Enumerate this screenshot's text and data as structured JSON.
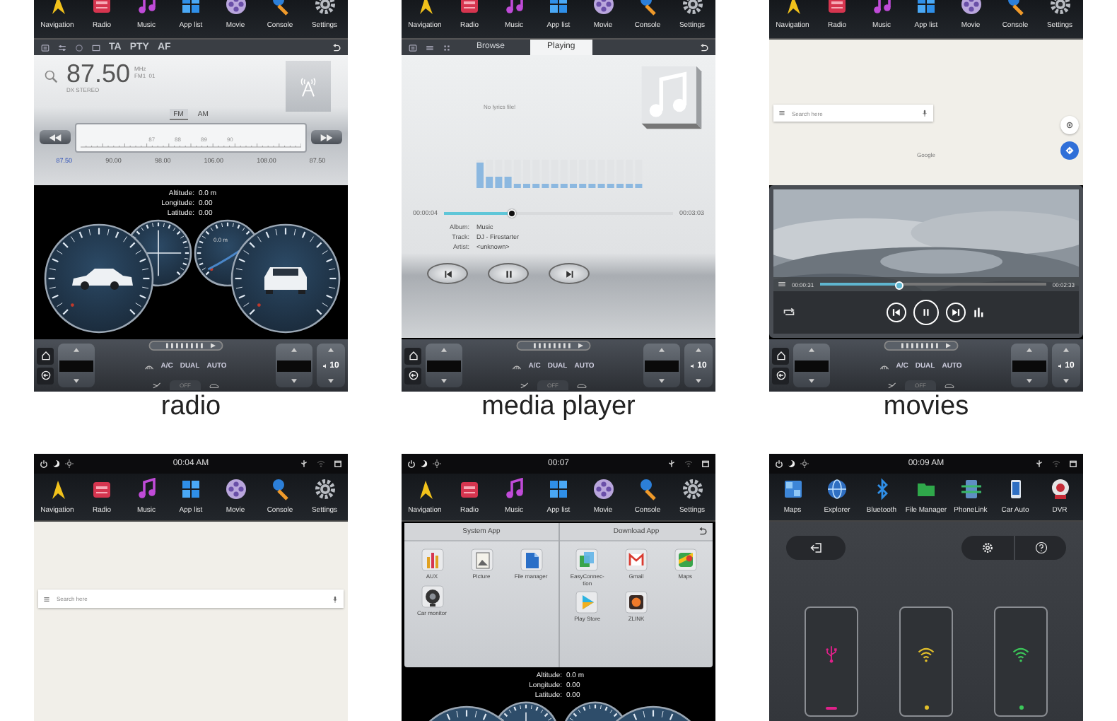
{
  "screens": [
    {
      "kind": "radio",
      "dock": [
        {
          "kind": "navigation",
          "label": "Navigation"
        },
        {
          "kind": "radio",
          "label": "Radio"
        },
        {
          "kind": "music",
          "label": "Music"
        },
        {
          "kind": "apps",
          "label": "App list"
        },
        {
          "kind": "movie",
          "label": "Movie"
        },
        {
          "kind": "console",
          "label": "Console"
        },
        {
          "kind": "settings",
          "label": "Settings"
        }
      ],
      "radio": {
        "toolbar": [
          "TA",
          "PTY",
          "AF"
        ],
        "frequency": "87.50",
        "unit": "MHz",
        "band_info": "FM1  01",
        "stereo": "DX STEREO",
        "bands": [
          {
            "label": "FM",
            "selected": true
          },
          {
            "label": "AM",
            "selected": false
          }
        ],
        "scale": [
          "87",
          "88",
          "89",
          "90"
        ],
        "presets": [
          {
            "label": "87.50",
            "selected": true
          },
          {
            "label": "90.00",
            "selected": false
          },
          {
            "label": "98.00",
            "selected": false
          },
          {
            "label": "106.00",
            "selected": false
          },
          {
            "label": "108.00",
            "selected": false
          },
          {
            "label": "87.50",
            "selected": false
          }
        ]
      },
      "gps": [
        {
          "label": "Altitude:",
          "value": "0.0 m"
        },
        {
          "label": "Longitude:",
          "value": "0.00"
        },
        {
          "label": "Latitude:",
          "value": "0.00"
        }
      ],
      "gauge_reading": "0.0 m",
      "climate": {
        "modes": [
          "A/C",
          "DUAL",
          "AUTO"
        ],
        "off": "OFF",
        "volume": "10"
      },
      "caption": "radio"
    },
    {
      "kind": "media",
      "dock": [
        {
          "kind": "navigation",
          "label": "Navigation"
        },
        {
          "kind": "radio",
          "label": "Radio"
        },
        {
          "kind": "music",
          "label": "Music"
        },
        {
          "kind": "apps",
          "label": "App list"
        },
        {
          "kind": "movie",
          "label": "Movie"
        },
        {
          "kind": "console",
          "label": "Console"
        },
        {
          "kind": "settings",
          "label": "Settings"
        }
      ],
      "media": {
        "tabs": [
          {
            "label": "Browse",
            "selected": false
          },
          {
            "label": "Playing",
            "selected": true
          }
        ],
        "lyrics": "No lyrics file!",
        "elapsed": "00:00:04",
        "duration": "00:03:03",
        "level": 0.3,
        "info": [
          {
            "label": "Album:",
            "value": "Music"
          },
          {
            "label": "Track:",
            "value": "DJ - Firestarter"
          },
          {
            "label": "Artist:",
            "value": "<unknown>"
          }
        ]
      },
      "climate": {
        "modes": [
          "A/C",
          "DUAL",
          "AUTO"
        ],
        "off": "OFF",
        "volume": "10"
      },
      "caption": "media player"
    },
    {
      "kind": "movies",
      "dock": [
        {
          "kind": "navigation",
          "label": "Navigation"
        },
        {
          "kind": "radio",
          "label": "Radio"
        },
        {
          "kind": "music",
          "label": "Music"
        },
        {
          "kind": "apps",
          "label": "App list"
        },
        {
          "kind": "movie",
          "label": "Movie"
        },
        {
          "kind": "console",
          "label": "Console"
        },
        {
          "kind": "settings",
          "label": "Settings"
        }
      ],
      "map": {
        "placeholder": "Search here",
        "credit": "Google"
      },
      "video": {
        "elapsed": "00:00:31",
        "duration": "00:02:33",
        "level": 0.36
      },
      "climate": {
        "modes": [
          "A/C",
          "DUAL",
          "AUTO"
        ],
        "off": "OFF",
        "volume": "10"
      },
      "caption": "movies"
    },
    {
      "kind": "map",
      "status": {
        "time": "00:04 AM"
      },
      "dock": [
        {
          "kind": "navigation",
          "label": "Navigation"
        },
        {
          "kind": "radio",
          "label": "Radio"
        },
        {
          "kind": "music",
          "label": "Music"
        },
        {
          "kind": "apps",
          "label": "App list"
        },
        {
          "kind": "movie",
          "label": "Movie"
        },
        {
          "kind": "console",
          "label": "Console"
        },
        {
          "kind": "settings",
          "label": "Settings"
        }
      ],
      "map": {
        "placeholder": "Search here"
      }
    },
    {
      "kind": "apps",
      "status": {
        "time": "00:07"
      },
      "dock": [
        {
          "kind": "navigation",
          "label": "Navigation"
        },
        {
          "kind": "radio",
          "label": "Radio"
        },
        {
          "kind": "music",
          "label": "Music"
        },
        {
          "kind": "apps",
          "label": "App list"
        },
        {
          "kind": "movie",
          "label": "Movie"
        },
        {
          "kind": "console",
          "label": "Console"
        },
        {
          "kind": "settings",
          "label": "Settings"
        }
      ],
      "apps": [
        {
          "title": "System App",
          "apps": [
            {
              "kind": "aux",
              "label": "AUX"
            },
            {
              "kind": "picture",
              "label": "Picture"
            },
            {
              "kind": "files",
              "label": "File manager"
            },
            {
              "kind": "camera",
              "label": "Car monitor"
            }
          ]
        },
        {
          "title": "Download App",
          "apps": [
            {
              "kind": "easyconnection",
              "label": "EasyConnec-tion"
            },
            {
              "kind": "gmail",
              "label": "Gmail"
            },
            {
              "kind": "maps",
              "label": "Maps"
            },
            {
              "kind": "playstore",
              "label": "Play Store"
            },
            {
              "kind": "zlink",
              "label": "ZLINK"
            }
          ]
        }
      ],
      "gps": [
        {
          "label": "Altitude:",
          "value": "0.0 m"
        },
        {
          "label": "Longitude:",
          "value": "0.00"
        },
        {
          "label": "Latitude:",
          "value": "0.00"
        }
      ]
    },
    {
      "kind": "phonelink",
      "status": {
        "time": "00:09 AM"
      },
      "dock": [
        {
          "kind": "maps",
          "label": "Maps"
        },
        {
          "kind": "explorer",
          "label": "Explorer"
        },
        {
          "kind": "bluetooth",
          "label": "Bluetooth"
        },
        {
          "kind": "folder",
          "label": "File Manager"
        },
        {
          "kind": "phonelink",
          "label": "PhoneLink"
        },
        {
          "kind": "carauto",
          "label": "Car Auto"
        },
        {
          "kind": "dvr",
          "label": "DVR"
        }
      ],
      "phones": [
        {
          "kind": "usb",
          "color": "#e0218a"
        },
        {
          "kind": "wifi",
          "color": "#e3c02a"
        },
        {
          "kind": "wifi",
          "color": "#3cc85a"
        }
      ]
    }
  ]
}
